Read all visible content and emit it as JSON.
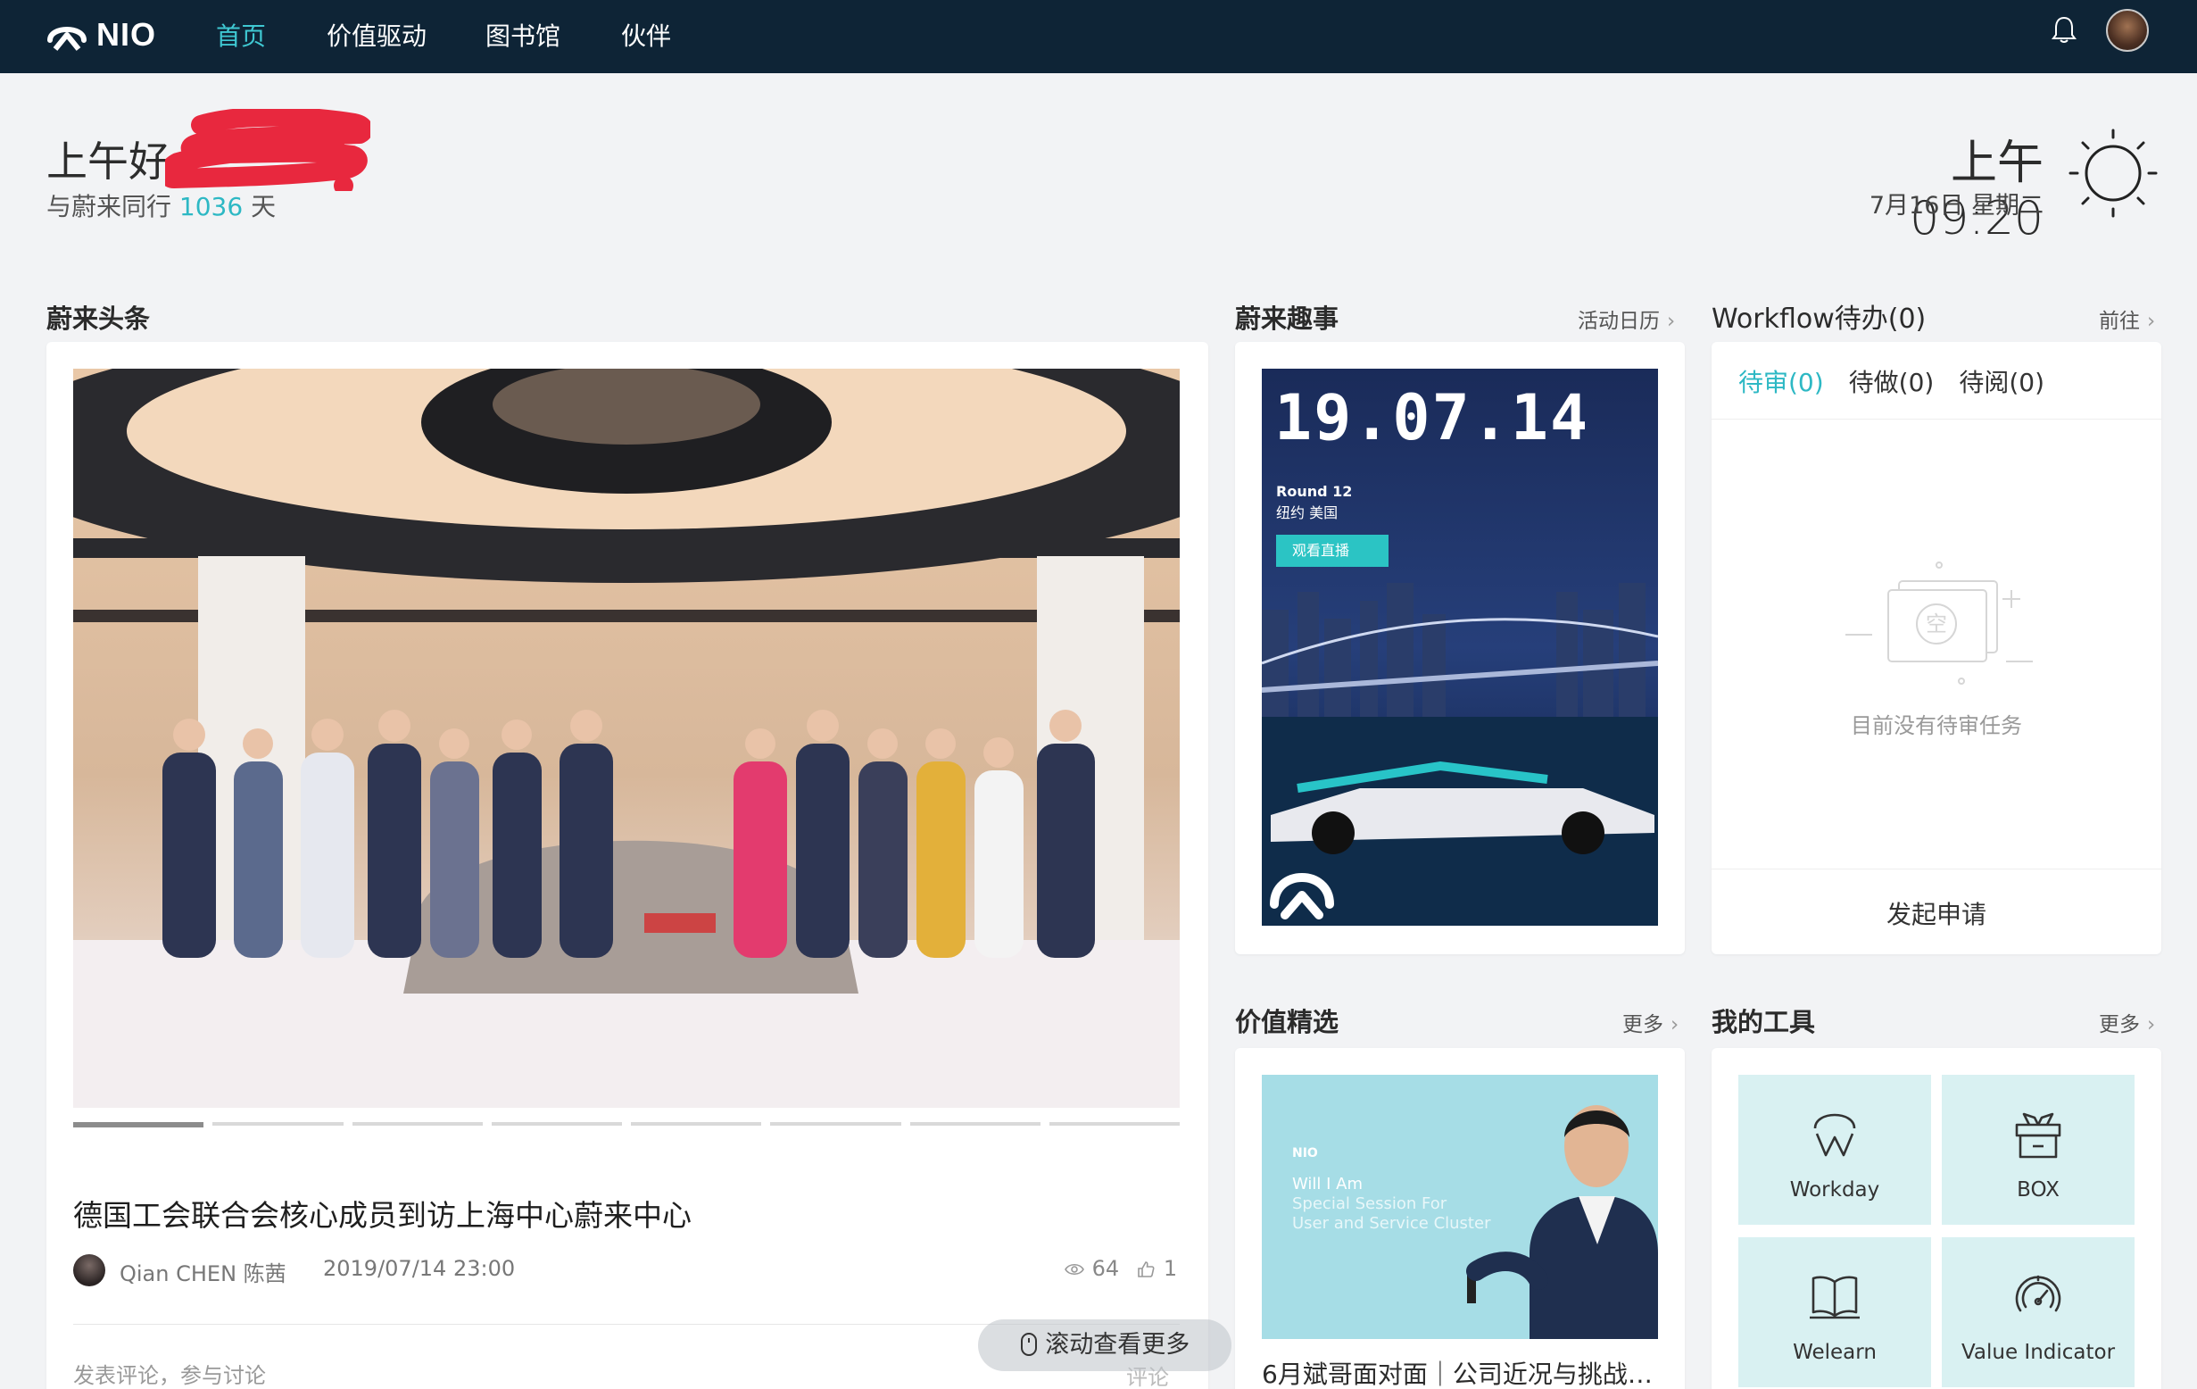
{
  "nav": {
    "logo_text": "NIO",
    "items": [
      {
        "label": "首页",
        "active": true
      },
      {
        "label": "价值驱动",
        "active": false
      },
      {
        "label": "图书馆",
        "active": false
      },
      {
        "label": "伙伴",
        "active": false
      }
    ],
    "icons": [
      "bell-icon",
      "user-avatar"
    ]
  },
  "greeting": {
    "hello": "上午好",
    "together_prefix": "与蔚来同行",
    "days": "1036",
    "together_suffix": "天",
    "time": "上午 09:20",
    "date": "7月16日 星期二",
    "weather_icon": "sun-icon"
  },
  "headlines": {
    "title": "蔚来头条",
    "carousel_total": 8,
    "carousel_active": 0,
    "news_title": "德国工会联合会核心成员到访上海中心蔚来中心",
    "author": "Qian CHEN 陈茜",
    "time": "2019/07/14 23:00",
    "views": "64",
    "likes": "1",
    "comment_placeholder": "发表评论，参与讨论",
    "comment_label": "评论",
    "scroll_hint": "滚动查看更多"
  },
  "fun": {
    "title": "蔚来趣事",
    "more": "活动日历",
    "poster": {
      "date": "19.07.14",
      "round": "Round 12",
      "city": "纽约 美国",
      "cta": "观看直播"
    }
  },
  "workflow": {
    "title": "Workflow待办(0)",
    "more": "前往",
    "tabs": [
      {
        "label": "待审(0)",
        "active": true
      },
      {
        "label": "待做(0)",
        "active": false
      },
      {
        "label": "待阅(0)",
        "active": false
      }
    ],
    "empty_icon_text": "空",
    "empty_text": "目前没有待审任务",
    "action": "发起申请"
  },
  "values": {
    "title": "价值精选",
    "more": "更多",
    "image_text": {
      "brand": "NIO",
      "line1": "Will I Am",
      "line2": "Special Session For",
      "line3": "User and Service Cluster"
    },
    "caption": "6月斌哥面对面｜公司近况与挑战…"
  },
  "tools": {
    "title": "我的工具",
    "more": "更多",
    "items": [
      {
        "label": "Workday",
        "icon": "workday-icon"
      },
      {
        "label": "BOX",
        "icon": "box-icon"
      },
      {
        "label": "Welearn",
        "icon": "book-icon"
      },
      {
        "label": "Value Indicator",
        "icon": "gauge-icon"
      }
    ]
  },
  "colors": {
    "nav_bg": "#0e2436",
    "accent": "#2db8c4",
    "page_bg": "#f2f3f5",
    "tool_bg": "#d9f1f2"
  }
}
